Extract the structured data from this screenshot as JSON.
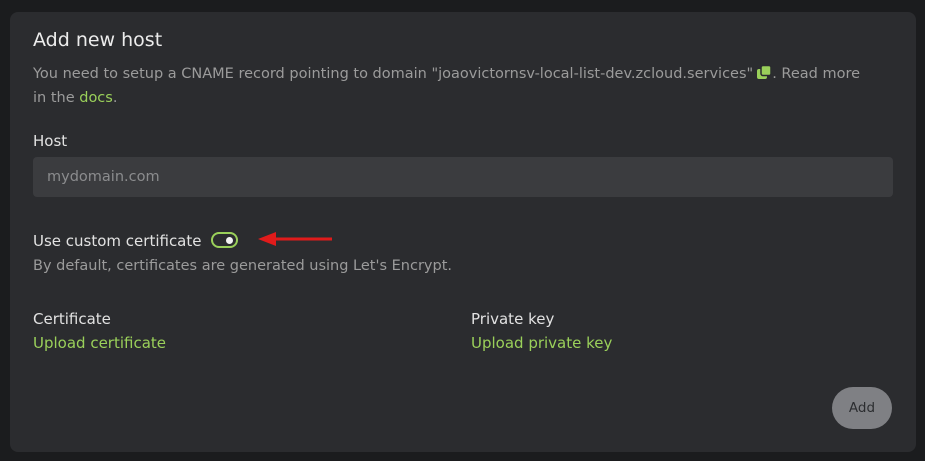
{
  "card": {
    "title": "Add new host",
    "description": {
      "prefix": "You need to setup a CNAME record pointing to domain \"joaovictornsv-local-list-dev.zcloud.services\"",
      "suffix": ". Read more in the ",
      "docs_link": "docs",
      "end": "."
    },
    "host": {
      "label": "Host",
      "placeholder": "mydomain.com",
      "value": ""
    },
    "custom_certificate": {
      "label": "Use custom certificate",
      "enabled": true,
      "hint": "By default, certificates are generated using Let's Encrypt."
    },
    "certificate": {
      "label": "Certificate",
      "link": "Upload certificate"
    },
    "private_key": {
      "label": "Private key",
      "link": "Upload private key"
    },
    "add_button": "Add"
  },
  "colors": {
    "page_bg": "#1b1c1e",
    "card_bg": "#2b2c2f",
    "input_bg": "#3b3c3f",
    "accent": "#9ad05a",
    "annotation_arrow": "#e01b1b",
    "button_bg": "#7f8084"
  },
  "icons": [
    "copy-icon",
    "annotation-arrow-icon"
  ]
}
